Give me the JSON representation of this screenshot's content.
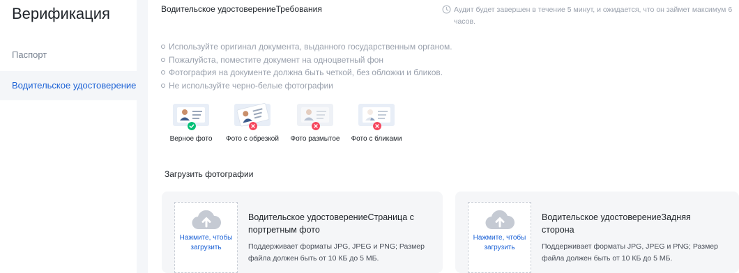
{
  "sidebar": {
    "title": "Верификация",
    "items": [
      {
        "label": "Паспорт",
        "active": false
      },
      {
        "label": "Водительское удостоверение",
        "active": true
      }
    ]
  },
  "header": {
    "doc_title": "Водительское удостоверениеТребования",
    "audit_text": "Аудит будет завершен в течение 5 минут, и ожидается, что он займет максимум 6 часов."
  },
  "requirements": [
    "Используйте оригинал документа, выданного государственным органом.",
    "Пожалуйста, поместите документ на одноцветный фон",
    "Фотография на документе должна быть четкой, без обложки и бликов.",
    "Не используйте черно-белые фотографии"
  ],
  "samples": [
    {
      "label": "Верное фото",
      "status": "ok"
    },
    {
      "label": "Фото с обрезкой",
      "status": "error"
    },
    {
      "label": "Фото размытое",
      "status": "error"
    },
    {
      "label": "Фото с бликами",
      "status": "error"
    }
  ],
  "upload": {
    "heading": "Загрузить фотографии",
    "click_text": "Нажмите, чтобы загрузить",
    "cards": [
      {
        "title": "Водительское удостоверениеСтраница с портретным фото",
        "hint": "Поддерживает форматы JPG, JPEG и PNG; Размер файла должен быть от 10 КБ до 5 МБ."
      },
      {
        "title": "Водительское удостоверениеЗадняя сторона",
        "hint": "Поддерживает форматы JPG, JPEG и PNG; Размер файла должен быть от 10 КБ до 5 МБ."
      }
    ]
  },
  "colors": {
    "accent": "#1c62d6",
    "ok": "#02c076",
    "error": "#f6465d",
    "muted": "#9aa1ad"
  },
  "icons": [
    "clock-icon",
    "check-icon",
    "cross-icon",
    "upload-cloud-icon",
    "id-card-icon"
  ]
}
